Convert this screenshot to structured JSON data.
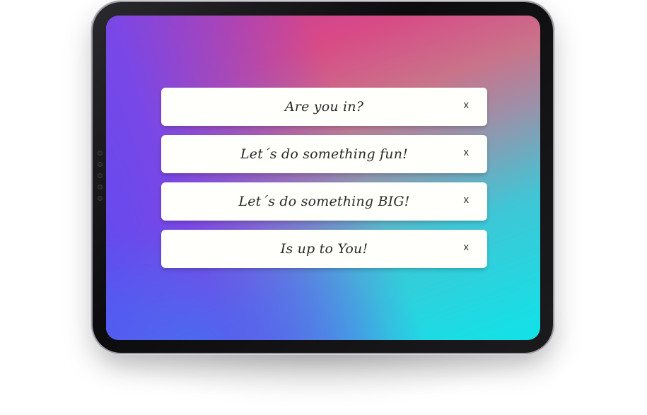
{
  "notifications": [
    {
      "text": "Are you in?",
      "close_label": "x"
    },
    {
      "text": "Let´s do something fun!",
      "close_label": "x"
    },
    {
      "text": "Let´s do something BIG!",
      "close_label": "x"
    },
    {
      "text": "Is up to You!",
      "close_label": "x"
    }
  ],
  "icons": {
    "close": "close-icon"
  },
  "colors": {
    "gradient_top_left": "#c53aa0",
    "gradient_top_right": "#d87a78",
    "gradient_left": "#7a47e6",
    "gradient_bottom_right": "#10e3e8",
    "card_background": "#fffffb",
    "text": "#2a2a2a"
  }
}
